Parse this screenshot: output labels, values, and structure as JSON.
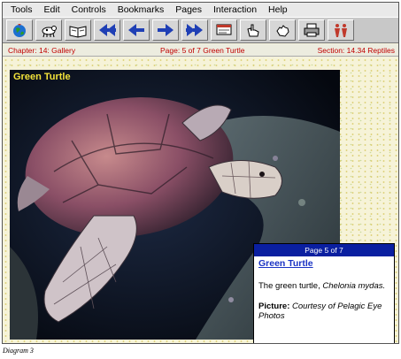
{
  "menu": [
    "Tools",
    "Edit",
    "Controls",
    "Bookmarks",
    "Pages",
    "Interaction",
    "Help"
  ],
  "toolbar": {
    "buttons": [
      {
        "icon": "globe-icon"
      },
      {
        "icon": "animal-icon"
      },
      {
        "icon": "book-icon"
      },
      {
        "icon": "double-arrow-left-icon"
      },
      {
        "icon": "arrow-left-icon"
      },
      {
        "icon": "arrow-right-icon"
      },
      {
        "icon": "double-arrow-right-icon"
      },
      {
        "icon": "note-icon"
      },
      {
        "icon": "hand-pointer-icon"
      },
      {
        "icon": "hand-icon"
      },
      {
        "icon": "printer-icon"
      },
      {
        "icon": "figures-icon"
      }
    ]
  },
  "status": {
    "chapter": "Chapter: 14: Gallery",
    "page": "Page: 5 of 7 Green Turtle",
    "section": "Section: 14.34 Reptiles"
  },
  "photo": {
    "title": "Green Turtle"
  },
  "popup": {
    "header": "Page 5 of 7",
    "title": "Green Turtle",
    "body_prefix": "The green turtle, ",
    "body_species": "Chelonia mydas.",
    "picture_label": "Picture:",
    "picture_credit": "Courtesy of Pelagic Eye Photos"
  },
  "caption": "Diagram 3",
  "colors": {
    "status_text": "#c00000",
    "photo_title": "#f2e23a",
    "popup_header": "#0a1fa0",
    "popup_title": "#1a33c4"
  }
}
